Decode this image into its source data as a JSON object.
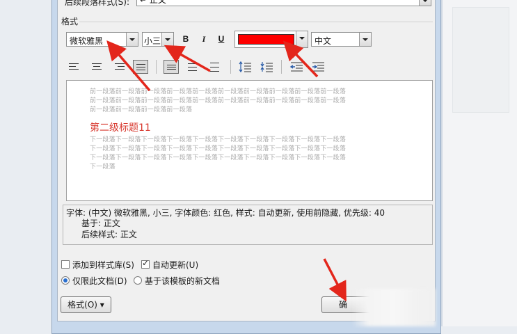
{
  "top_partial": {
    "label": "后续段落样式(S):",
    "value": "↵ 正文"
  },
  "section": {
    "format_label": "格式"
  },
  "toolbar": {
    "font_name": "微软雅黑",
    "font_size": "小三",
    "bold": "B",
    "italic": "I",
    "underline": "U",
    "font_color": "#ff0000",
    "language": "中文"
  },
  "preview": {
    "prev_paragraph": "前一段落前一段落前一段落前一段落前一段落前一段落前一段落前一段落前一段落前一段落\n前一段落前一段落前一段落前一段落前一段落前一段落前一段落前一段落前一段落前一段落\n前一段落前一段落前一段落前一段落",
    "heading": "第二级标题11",
    "heading_color": "#d8392f",
    "next_paragraph": "下一段落下一段落下一段落下一段落下一段落下一段落下一段落下一段落下一段落下一段落\n下一段落下一段落下一段落下一段落下一段落下一段落下一段落下一段落下一段落下一段落\n下一段落下一段落下一段落下一段落下一段落下一段落下一段落下一段落下一段落下一段落\n下一段落"
  },
  "description": {
    "line1": "字体: (中文) 微软雅黑, 小三, 字体颜色: 红色, 样式: 自动更新, 使用前隐藏, 优先级: 40",
    "line2": "基于: 正文",
    "line3": "后续样式: 正文"
  },
  "options": {
    "add_to_gallery": "添加到样式库(S)",
    "auto_update": "自动更新(U)",
    "this_document_only": "仅限此文档(D)",
    "new_docs_template": "基于该模板的新文档"
  },
  "buttons": {
    "format": "格式(O) ▾",
    "ok": "确"
  }
}
